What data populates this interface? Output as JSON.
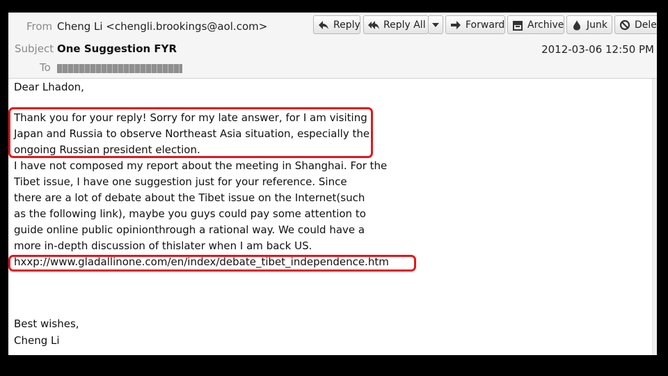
{
  "header": {
    "from_label": "From",
    "from_value": "Cheng Li <chengli.brookings@aol.com>",
    "subject_label": "Subject",
    "subject_value": "One Suggestion FYR",
    "to_label": "To",
    "date": "2012-03-06 12:50 PM"
  },
  "toolbar": {
    "reply": "Reply",
    "reply_all": "Reply All",
    "forward": "Forward",
    "archive": "Archive",
    "junk": "Junk",
    "delete": "Delete"
  },
  "message": {
    "greeting": "Dear Lhadon,",
    "lines": [
      "Thank you for your reply! Sorry for my late answer, for I am visiting",
      "Japan and Russia to observe Northeast Asia situation, especially the",
      "ongoing Russian president election.",
      "I have not composed my report about the meeting in Shanghai. For the",
      "Tibet issue, I have one suggestion just for your reference. Since",
      "there are a lot of debate about the Tibet issue on the Internet(such",
      "as the following link), maybe you guys could pay some attention to",
      "guide online public opinionthrough a rational way. We could have a",
      "more in-depth discussion of thislater when I am back US.",
      "hxxp://www.gladallinone.com/en/index/debate_tibet_independence.htm"
    ],
    "closing": "Best wishes,",
    "signature": "Cheng Li"
  },
  "colors": {
    "highlight": "#e8141b",
    "header_bg": "#f5f5f5",
    "frame": "#000000"
  },
  "icons": [
    "reply-arrow-icon",
    "reply-all-arrow-icon",
    "forward-arrow-icon",
    "archive-box-icon",
    "junk-flame-icon",
    "delete-circle-icon",
    "dropdown-caret-icon"
  ]
}
